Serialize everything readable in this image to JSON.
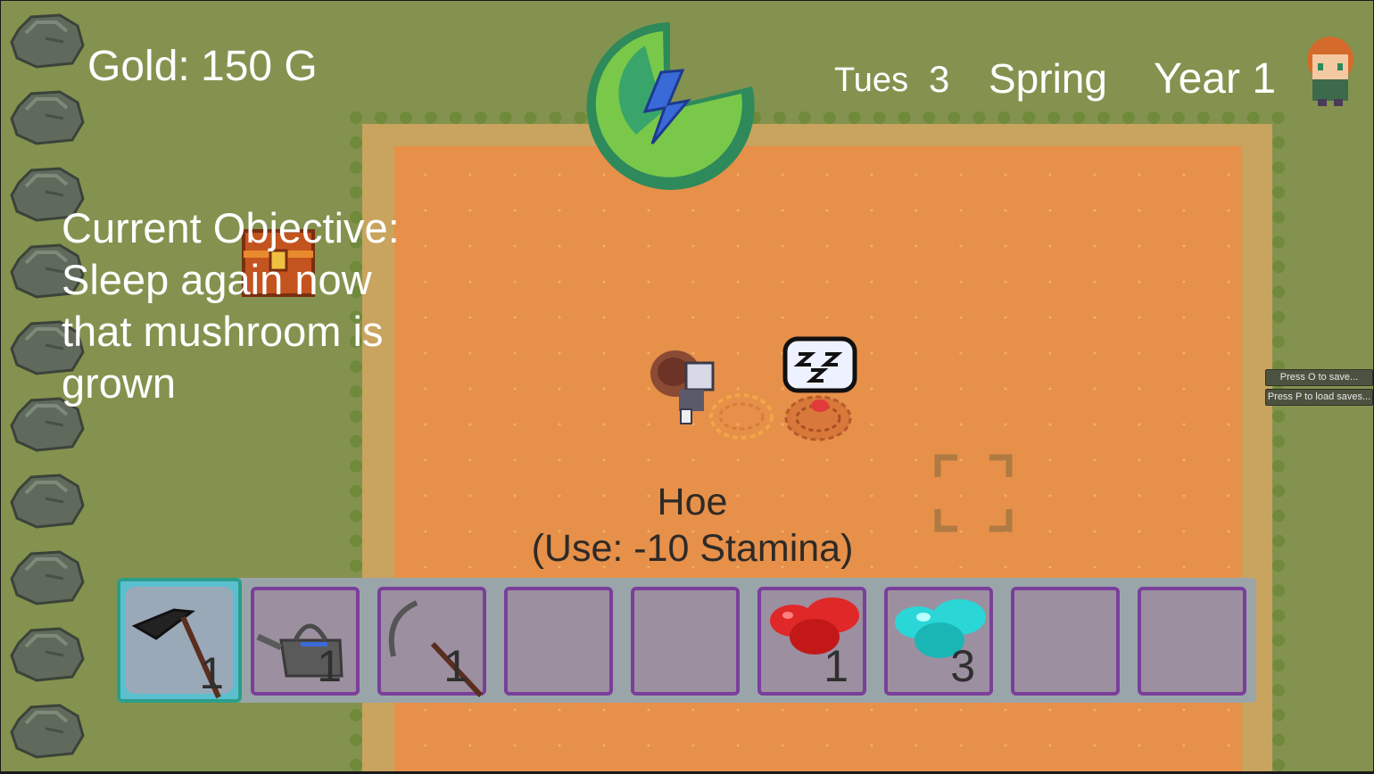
{
  "hud": {
    "gold_label": "Gold:",
    "gold_value": "150 G",
    "day_name": "Tues",
    "day_number": "3",
    "season": "Spring",
    "year": "Year 1"
  },
  "objective": {
    "lines": [
      "Current Objective:",
      "Sleep again now",
      "that mushroom is",
      "grown"
    ]
  },
  "tooltip": {
    "item_name": "Hoe",
    "item_use": "(Use: -10 Stamina)"
  },
  "buttons": {
    "save": "Press O to save...",
    "load": "Press P to load saves..."
  },
  "hotbar": {
    "selected_index": 0,
    "slots": [
      {
        "item": "hoe",
        "count": "1"
      },
      {
        "item": "watering-can",
        "count": "1"
      },
      {
        "item": "scythe",
        "count": "1"
      },
      {
        "item": "",
        "count": ""
      },
      {
        "item": "",
        "count": ""
      },
      {
        "item": "red-berries",
        "count": "1"
      },
      {
        "item": "teal-gems",
        "count": "3"
      },
      {
        "item": "",
        "count": ""
      },
      {
        "item": "",
        "count": ""
      }
    ]
  },
  "colors": {
    "grass": "#84924f",
    "soil": "#e6904a",
    "slot_border": "#7a3f9a",
    "selected_border": "#2a9e8a"
  }
}
